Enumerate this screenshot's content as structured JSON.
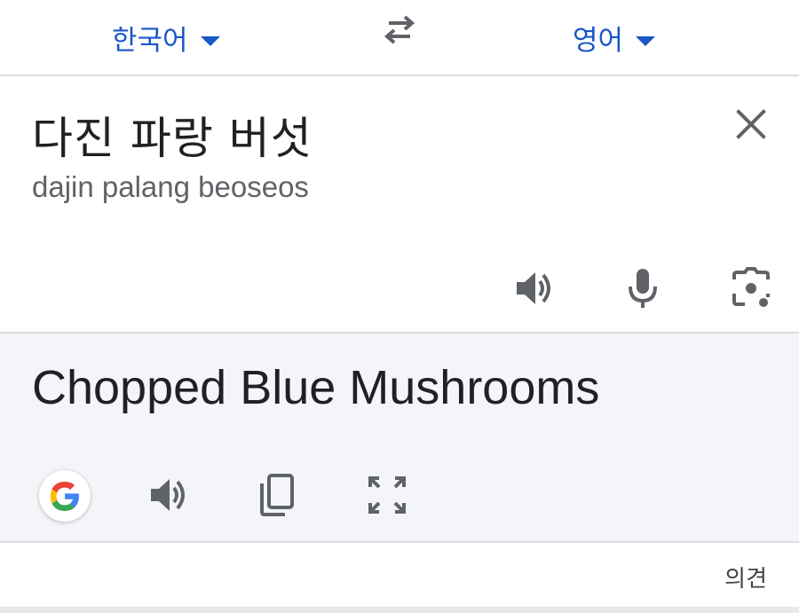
{
  "language_bar": {
    "source_language": "한국어",
    "target_language": "영어",
    "swap_icon": "swap-horiz-icon"
  },
  "input": {
    "source_text": "다진 파랑 버섯",
    "romanization": "dajin palang beoseos",
    "icons": [
      "close-icon",
      "speaker-icon",
      "mic-icon",
      "camera-icon"
    ]
  },
  "output": {
    "translated_text": "Chopped Blue Mushrooms",
    "icons": [
      "google-icon",
      "speaker-icon",
      "copy-icon",
      "fullscreen-icon"
    ]
  },
  "footer": {
    "feedback_label": "의견"
  },
  "colors": {
    "accent": "#1a57c8",
    "icon": "#5f6368",
    "output_bg": "#f4f5f8",
    "divider": "#dadce0"
  }
}
